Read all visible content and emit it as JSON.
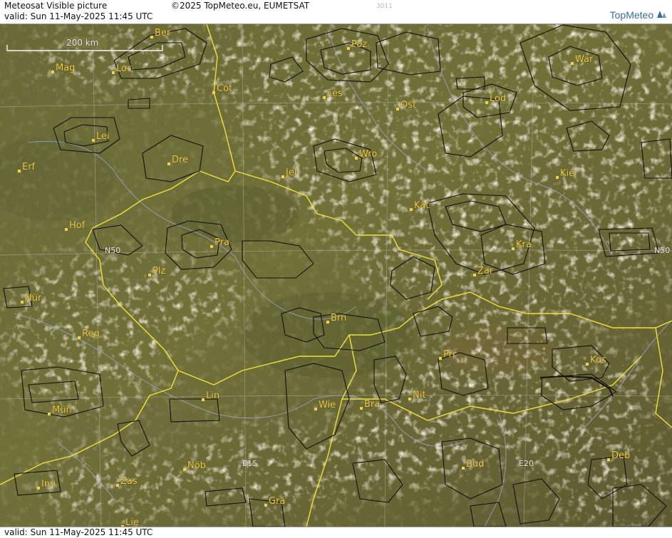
{
  "header": {
    "product": "Meteosat Visible picture",
    "copyright": "©2025 TopMeteo.eu, EUMETSAT",
    "code": "3011",
    "valid": "valid:  Sun  11-May-2025  11:45 UTC",
    "logo": "TopMeteo"
  },
  "scale_bar": {
    "label": "200 km"
  },
  "grid_labels": [
    "N50",
    "N50",
    "E15",
    "E20"
  ],
  "cities": [
    {
      "name": "Ber"
    },
    {
      "name": "Mag"
    },
    {
      "name": "Loc"
    },
    {
      "name": "Cot"
    },
    {
      "name": "Lei"
    },
    {
      "name": "Dre"
    },
    {
      "name": "Erf"
    },
    {
      "name": "Poz"
    },
    {
      "name": "Les"
    },
    {
      "name": "Ost"
    },
    {
      "name": "Wro"
    },
    {
      "name": "Jel"
    },
    {
      "name": "Lod"
    },
    {
      "name": "War"
    },
    {
      "name": "Kie"
    },
    {
      "name": "Kat"
    },
    {
      "name": "Kra"
    },
    {
      "name": "Zar"
    },
    {
      "name": "Hof"
    },
    {
      "name": "Pra"
    },
    {
      "name": "Plz"
    },
    {
      "name": "Nür"
    },
    {
      "name": "Reg"
    },
    {
      "name": "Brn"
    },
    {
      "name": "Pri"
    },
    {
      "name": "Kos"
    },
    {
      "name": "Nit"
    },
    {
      "name": "Bra"
    },
    {
      "name": "Wie"
    },
    {
      "name": "Lin"
    },
    {
      "name": "Mün"
    },
    {
      "name": "Zas"
    },
    {
      "name": "Nöb"
    },
    {
      "name": "Inn"
    },
    {
      "name": "Bud"
    },
    {
      "name": "Deb"
    },
    {
      "name": "Gra"
    },
    {
      "name": "Lie"
    }
  ],
  "colors": {
    "land": "#6e6a36",
    "cloud": "#d4c29e",
    "border": "#f0e23a",
    "river": "#9aa3c8",
    "outline": "#111111"
  },
  "footer": {
    "valid": "valid:  Sun  11-May-2025  11:45 UTC"
  }
}
